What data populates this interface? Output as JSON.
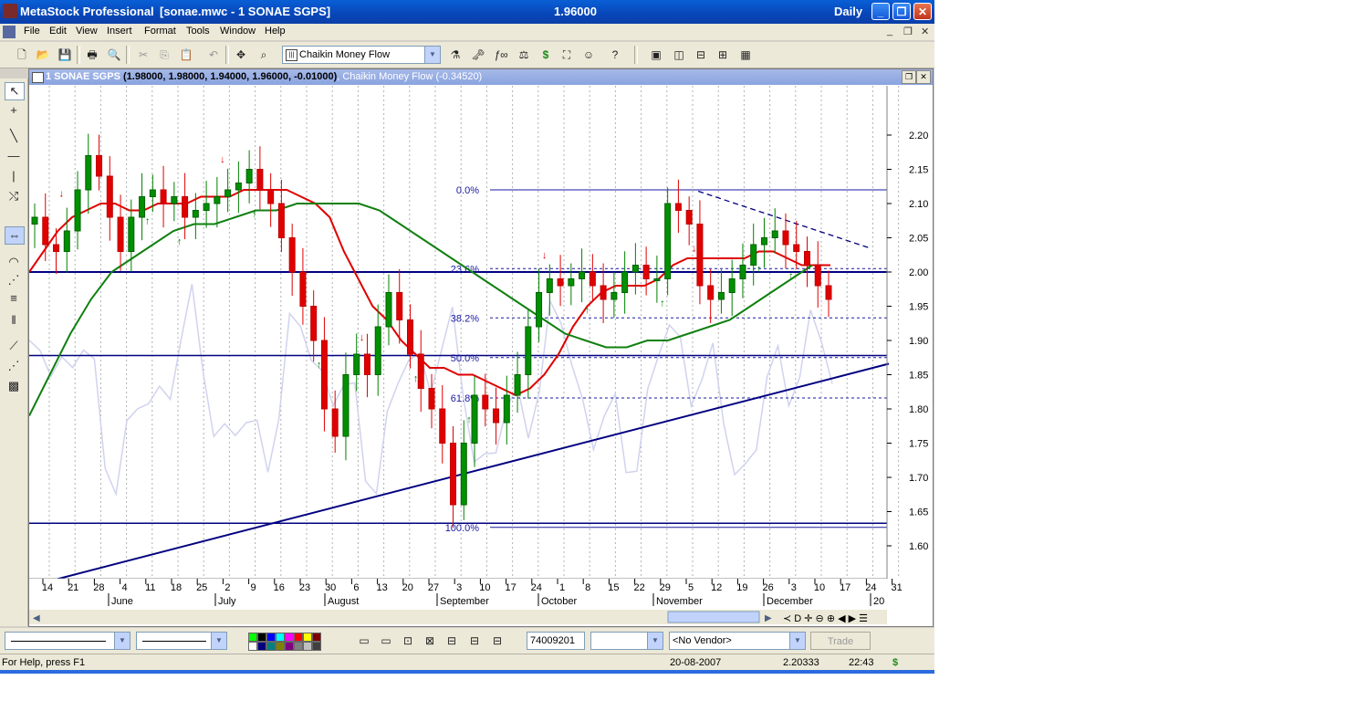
{
  "window": {
    "app_name": "MetaStock Professional",
    "doc": "[sonae.mwc - 1 SONAE SGPS]",
    "price": "1.96000",
    "period": "Daily",
    "minimize": "_",
    "restore": "❐",
    "close": "✕"
  },
  "menu": [
    "File",
    "Edit",
    "View",
    "Insert",
    "Format",
    "Tools",
    "Window",
    "Help"
  ],
  "toolbar": {
    "indicator_select": "Chaikin Money Flow"
  },
  "chart_window": {
    "security": "1 SONAE SGPS",
    "ohlc": "(1.98000, 1.98000, 1.94000, 1.96000, -0.01000)",
    "indicator": "Chaikin Money Flow",
    "indicator_value": "(-0.34520)"
  },
  "bottom_toolbar": {
    "value_field": "74009201",
    "vendor_select": "<No Vendor>",
    "trade_button": "Trade"
  },
  "status": {
    "help": "For Help, press F1",
    "date": "20-08-2007",
    "value": "2.20333",
    "time": "22:43",
    "dollar": "$"
  },
  "chart_data": {
    "type": "candlestick",
    "security": "SONAE SGPS",
    "ylim": [
      1.55,
      2.27
    ],
    "y_ticks": [
      "2.20",
      "2.15",
      "2.10",
      "2.05",
      "2.00",
      "1.95",
      "1.90",
      "1.85",
      "1.80",
      "1.75",
      "1.70",
      "1.65",
      "1.60"
    ],
    "x_day_ticks": [
      "14",
      "21",
      "28",
      "4",
      "11",
      "18",
      "25",
      "2",
      "9",
      "16",
      "23",
      "30",
      "6",
      "13",
      "20",
      "27",
      "3",
      "10",
      "17",
      "24",
      "1",
      "8",
      "15",
      "22",
      "29",
      "5",
      "12",
      "19",
      "26",
      "3",
      "10",
      "17",
      "24",
      "31"
    ],
    "x_month_labels": [
      "June",
      "July",
      "August",
      "September",
      "October",
      "November",
      "December",
      "20"
    ],
    "fibonacci_levels": [
      {
        "label": "0.0%",
        "price": 2.12
      },
      {
        "label": "23.6%",
        "price": 2.005
      },
      {
        "label": "38.2%",
        "price": 1.933
      },
      {
        "label": "50.0%",
        "price": 1.875
      },
      {
        "label": "61.8%",
        "price": 1.816
      },
      {
        "label": "100.0%",
        "price": 1.627
      }
    ],
    "horizontal_lines": [
      2.0,
      1.878,
      1.633
    ],
    "trendline": {
      "from": [
        0,
        1.545
      ],
      "to": [
        1,
        1.866
      ]
    },
    "resistance_line": {
      "from": [
        0.78,
        2.118
      ],
      "to": [
        0.98,
        2.035
      ]
    },
    "price_path": [
      2.08,
      2.04,
      2.03,
      2.06,
      2.12,
      2.17,
      2.14,
      2.08,
      2.03,
      2.08,
      2.11,
      2.12,
      2.1,
      2.11,
      2.08,
      2.09,
      2.1,
      2.11,
      2.12,
      2.13,
      2.15,
      2.12,
      2.1,
      2.05,
      2.0,
      1.95,
      1.9,
      1.8,
      1.76,
      1.85,
      1.88,
      1.85,
      1.92,
      1.97,
      1.93,
      1.88,
      1.83,
      1.8,
      1.75,
      1.66,
      1.75,
      1.82,
      1.8,
      1.78,
      1.82,
      1.85,
      1.92,
      1.97,
      1.99,
      1.98,
      1.99,
      2.0,
      1.98,
      1.96,
      1.97,
      2.0,
      2.01,
      1.99,
      1.99,
      2.1,
      2.09,
      2.07,
      1.98,
      1.96,
      1.97,
      1.99,
      2.01,
      2.04,
      2.05,
      2.06,
      2.04,
      2.03,
      2.01,
      1.98,
      1.96
    ],
    "ma_fast": [
      2.0,
      2.03,
      2.06,
      2.08,
      2.09,
      2.1,
      2.1,
      2.09,
      2.09,
      2.1,
      2.1,
      2.1,
      2.11,
      2.11,
      2.11,
      2.12,
      2.12,
      2.12,
      2.12,
      2.11,
      2.1,
      2.08,
      2.03,
      1.99,
      1.95,
      1.93,
      1.9,
      1.88,
      1.86,
      1.86,
      1.85,
      1.85,
      1.84,
      1.83,
      1.82,
      1.83,
      1.85,
      1.88,
      1.92,
      1.95,
      1.97,
      1.98,
      1.98,
      1.98,
      1.99,
      2.01,
      2.02,
      2.02,
      2.02,
      2.02,
      2.02,
      2.03,
      2.03,
      2.02,
      2.01,
      2.01,
      2.01
    ],
    "ma_slow": [
      1.79,
      1.85,
      1.91,
      1.96,
      2.0,
      2.02,
      2.04,
      2.06,
      2.07,
      2.07,
      2.08,
      2.09,
      2.09,
      2.1,
      2.1,
      2.1,
      2.1,
      2.09,
      2.07,
      2.05,
      2.03,
      2.01,
      1.99,
      1.97,
      1.95,
      1.93,
      1.91,
      1.9,
      1.89,
      1.89,
      1.9,
      1.9,
      1.91,
      1.92,
      1.93,
      1.95,
      1.97,
      1.99,
      2.01
    ]
  }
}
